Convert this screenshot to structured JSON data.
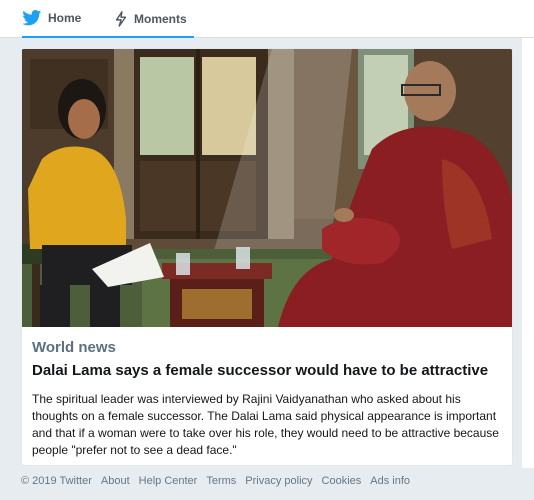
{
  "nav": {
    "home_label": "Home",
    "moments_label": "Moments",
    "accent": "#1da1f2"
  },
  "card": {
    "category": "World news",
    "headline": "Dalai Lama says a female successor would have to be attractive",
    "summary": "The spiritual leader was interviewed by Rajini Vaidyanathan who asked about his thoughts on a female successor. The Dalai Lama said physical appearance is important and that if a woman were to take over his role, they would need to be attractive because people \"prefer not to see a dead face.\""
  },
  "footer": {
    "copyright": "© 2019 Twitter",
    "links": [
      "About",
      "Help Center",
      "Terms",
      "Privacy policy",
      "Cookies",
      "Ads info"
    ]
  }
}
